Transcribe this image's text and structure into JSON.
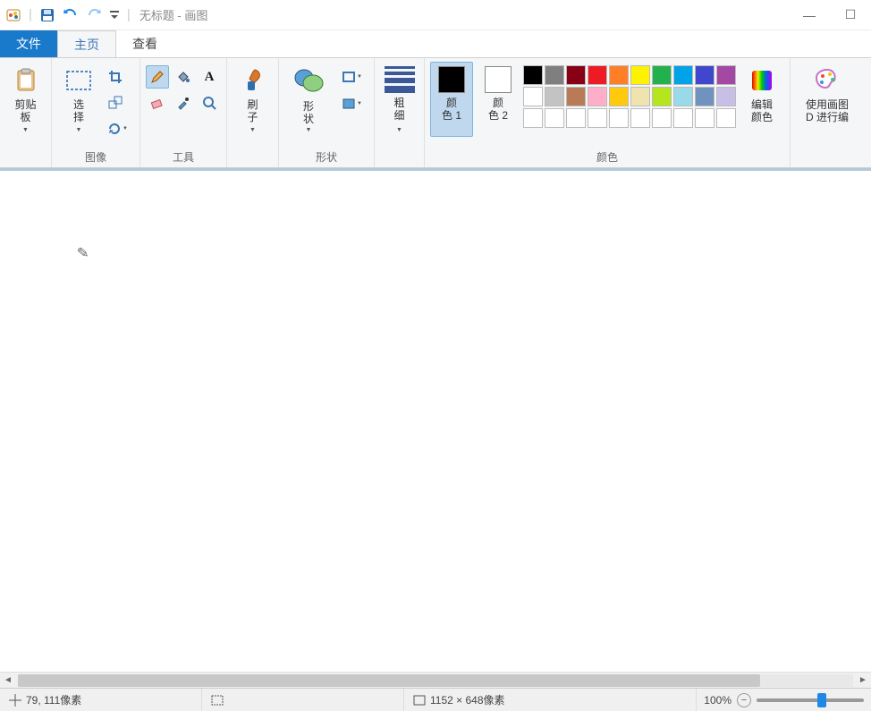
{
  "title": "无标题 - 画图",
  "window_buttons": {
    "min": "—",
    "max": "☐",
    "close": "✕"
  },
  "qat": {
    "icons": [
      "app-icon",
      "save-icon",
      "undo-icon",
      "redo-icon",
      "chevron-down-icon"
    ],
    "sep": "|"
  },
  "tabs": {
    "file": "文件",
    "home": "主页",
    "view": "查看"
  },
  "ribbon": {
    "clipboard": {
      "label": "剪贴板",
      "button": "剪贴\n板"
    },
    "image": {
      "group_label": "图像",
      "select": "选\n择",
      "tools": [
        "crop-icon",
        "resize-icon",
        "rotate-icon"
      ]
    },
    "tools": {
      "group_label": "工具",
      "items": [
        "pencil-icon",
        "fill-icon",
        "text-icon",
        "eraser-icon",
        "eyedropper-icon",
        "magnifier-icon"
      ]
    },
    "brushes": {
      "label": "刷\n子"
    },
    "shapes": {
      "group_label": "形状",
      "label": "形\n状",
      "mini": [
        "shape-outline-icon",
        "shape-fill-icon"
      ]
    },
    "stroke": {
      "label": "粗\n细"
    },
    "color1": {
      "label": "颜\n色 1",
      "value": "#000000"
    },
    "color2": {
      "label": "颜\n色 2",
      "value": "#ffffff"
    },
    "palette_label": "颜色",
    "palette": [
      [
        "#000000",
        "#7f7f7f",
        "#880015",
        "#ed1c24",
        "#ff7f27",
        "#fff200",
        "#22b14c",
        "#00a2e8",
        "#3f48cc",
        "#a349a4"
      ],
      [
        "#ffffff",
        "#c3c3c3",
        "#b97a57",
        "#ffaec9",
        "#ffc90e",
        "#efe4b0",
        "#b5e61d",
        "#99d9ea",
        "#7092be",
        "#c8bfe7"
      ],
      [
        "#ffffff",
        "#ffffff",
        "#ffffff",
        "#ffffff",
        "#ffffff",
        "#ffffff",
        "#ffffff",
        "#ffffff",
        "#ffffff",
        "#ffffff"
      ]
    ],
    "edit_colors": "编辑\n颜色",
    "paint3d": "使用画图\nD 进行编"
  },
  "status": {
    "cursor_icon": "crosshair-icon",
    "cursor_pos": "79, 111像素",
    "selection_icon": "selection-rect-icon",
    "selection": "",
    "size_icon": "canvas-size-icon",
    "canvas_size": "1152 × 648像素",
    "zoom": "100%"
  }
}
